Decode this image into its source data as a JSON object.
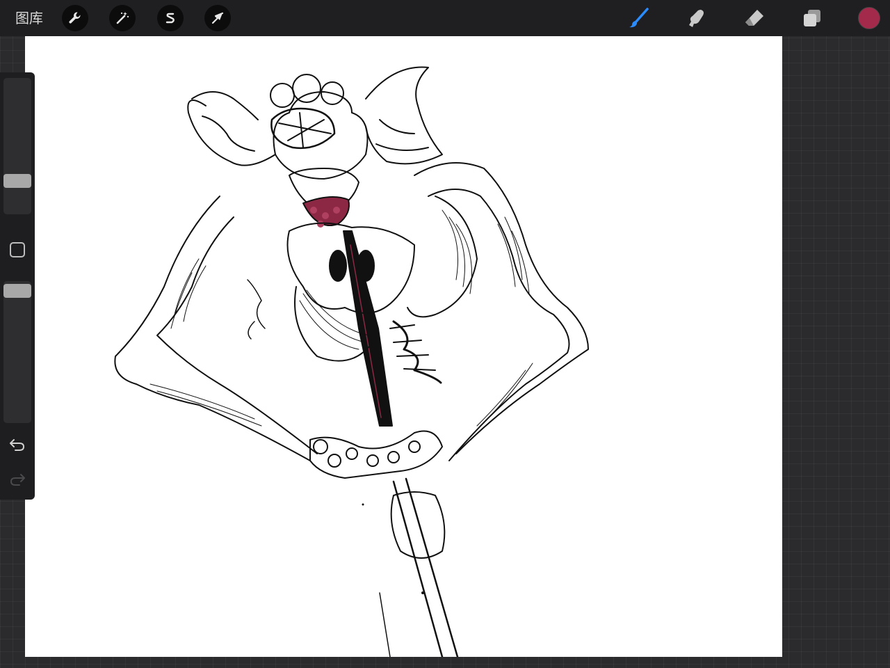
{
  "topbar": {
    "gallery_label": "图库",
    "actions": [
      {
        "name": "actions-button",
        "icon": "wrench-icon"
      },
      {
        "name": "adjustments-button",
        "icon": "magic-wand-icon"
      },
      {
        "name": "selection-button",
        "icon": "selection-s-icon"
      },
      {
        "name": "transform-button",
        "icon": "arrow-cursor-icon"
      }
    ],
    "tools": [
      {
        "name": "brush-tool",
        "icon": "brush-icon",
        "active": true
      },
      {
        "name": "smudge-tool",
        "icon": "smudge-finger-icon",
        "active": false
      },
      {
        "name": "eraser-tool",
        "icon": "eraser-icon",
        "active": false
      },
      {
        "name": "layers-button",
        "icon": "layers-icon",
        "active": false
      }
    ],
    "current_color": "#a42a4c"
  },
  "sidebar": {
    "brush_size": "brush-size-slider",
    "modify_button": "square-icon",
    "brush_opacity": "opacity-slider",
    "undo_icon": "undo-icon",
    "redo_icon": "redo-icon"
  },
  "colors": {
    "accent_active": "#2a8cff",
    "ink": "#111111",
    "tongue": "#8c2844"
  }
}
